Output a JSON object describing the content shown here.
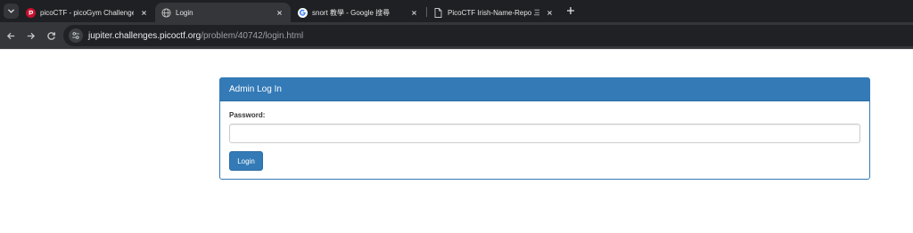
{
  "browser": {
    "tabs": [
      {
        "title": "picoCTF - picoGym Challenges",
        "favicon": "picoctf-icon",
        "active": false
      },
      {
        "title": "Login",
        "favicon": "globe-icon",
        "active": true
      },
      {
        "title": "snort 教學 - Google 搜尋",
        "favicon": "google-icon",
        "active": false
      },
      {
        "title": "PicoCTF Irish-Name-Repo 三部曲",
        "favicon": "page-icon",
        "active": false
      }
    ],
    "url": {
      "host": "jupiter.challenges.picoctf.org",
      "path": "/problem/40742/login.html"
    },
    "colors": {
      "tabstrip": "#1f2023",
      "toolbar": "#35363a",
      "omnibox": "#202124",
      "google_blue": "#4285f4",
      "picoctf_red": "#c8102e"
    }
  },
  "page": {
    "panel_title": "Admin Log In",
    "password_label": "Password:",
    "password_value": "",
    "login_button": "Login",
    "colors": {
      "primary": "#337ab7",
      "primary_border": "#2e6da4",
      "label": "#333333"
    }
  }
}
